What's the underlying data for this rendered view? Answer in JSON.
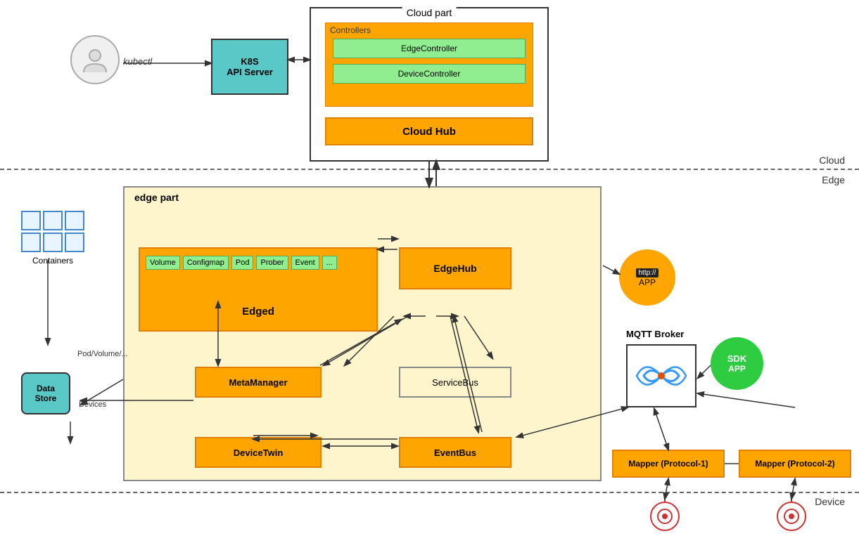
{
  "diagram": {
    "sections": {
      "cloud_label": "Cloud",
      "edge_label": "Edge",
      "device_label": "Device"
    },
    "cloud_part": {
      "title": "Cloud part",
      "controllers": {
        "label": "Controllers",
        "edge_controller": "EdgeController",
        "device_controller": "DeviceController"
      },
      "cloud_hub": "Cloud Hub"
    },
    "k8s": {
      "label": "K8S\nAPI Server"
    },
    "kubectl": "kubectl",
    "edge_part": {
      "title": "edge part",
      "edged": {
        "label": "Edged",
        "modules": [
          "Volume",
          "Configmap",
          "Pod",
          "Prober",
          "Event",
          "..."
        ]
      },
      "edgehub": "EdgeHub",
      "metamanager": "MetaManager",
      "servicebus": "ServiceBus",
      "devicetwin": "DeviceTwin",
      "eventbus": "EventBus"
    },
    "containers": {
      "label": "Containers"
    },
    "datastore": {
      "label": "Data\nStore"
    },
    "http_app": {
      "badge": "http://",
      "label": "APP"
    },
    "mqtt": {
      "title": "MQTT Broker"
    },
    "sdk_app": {
      "sdk": "SDK",
      "app": "APP"
    },
    "mapper1": "Mapper (Protocol-1)",
    "mapper2": "Mapper (Protocol-2)",
    "pod_volume": "Pod/Volume/...",
    "devices": "Devices"
  }
}
